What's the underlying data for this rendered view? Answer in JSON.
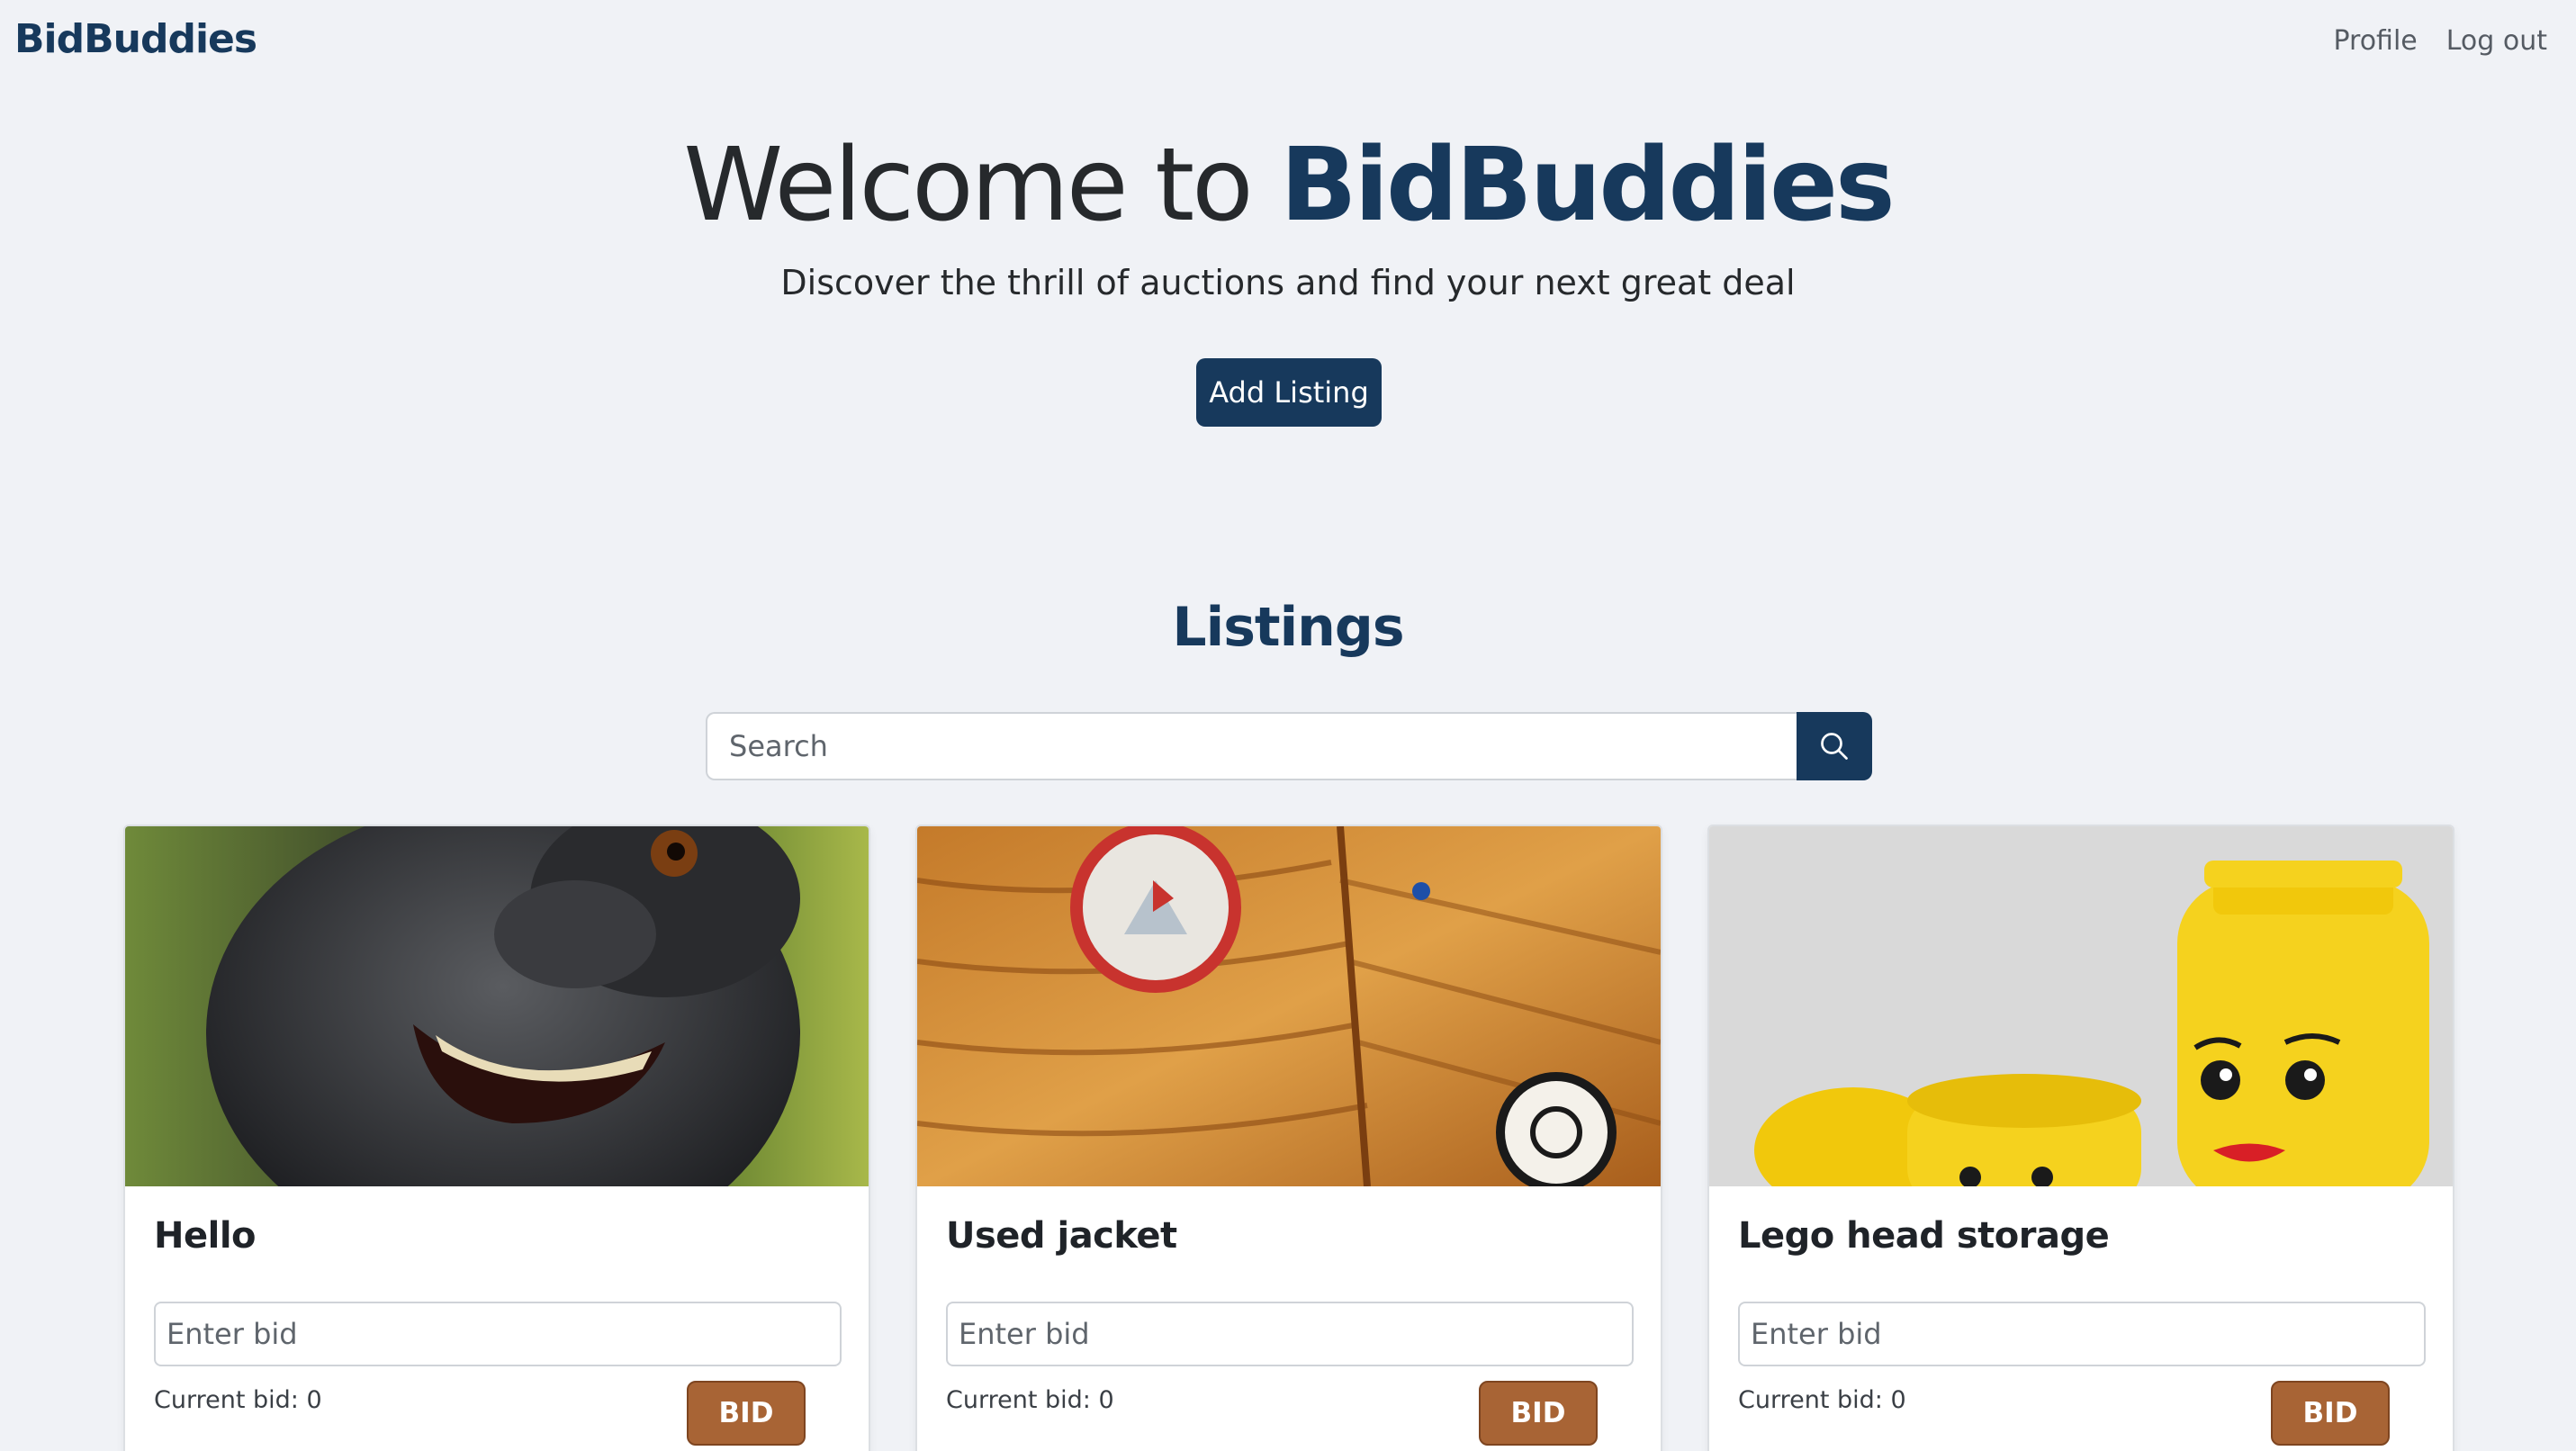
{
  "nav": {
    "brand": "BidBuddies",
    "links": [
      "Profile",
      "Log out"
    ]
  },
  "hero": {
    "title_prefix": "Welcome to ",
    "title_brand": "BidBuddies",
    "subtitle": "Discover the thrill of auctions and find your next great deal",
    "add_listing_label": "Add Listing"
  },
  "listings": {
    "heading": "Listings",
    "search_placeholder": "Search",
    "cards": [
      {
        "title": "Hello",
        "image": "macaque-selfie-photo",
        "bid_placeholder": "Enter bid",
        "current_bid": "Current bid: 0",
        "bid_label": "BID"
      },
      {
        "title": "Used jacket",
        "image": "orange-down-jacket-photo",
        "bid_placeholder": "Enter bid",
        "current_bid": "Current bid: 0",
        "bid_label": "BID"
      },
      {
        "title": "Lego head storage",
        "image": "lego-head-storage-photo",
        "bid_placeholder": "Enter bid",
        "current_bid": "Current bid: 0",
        "bid_label": "BID"
      }
    ]
  },
  "colors": {
    "background": "#f0f2f6",
    "brand_navy": "#17395c",
    "bid_button": "#a86435"
  },
  "icons": {
    "search": "search-icon"
  }
}
